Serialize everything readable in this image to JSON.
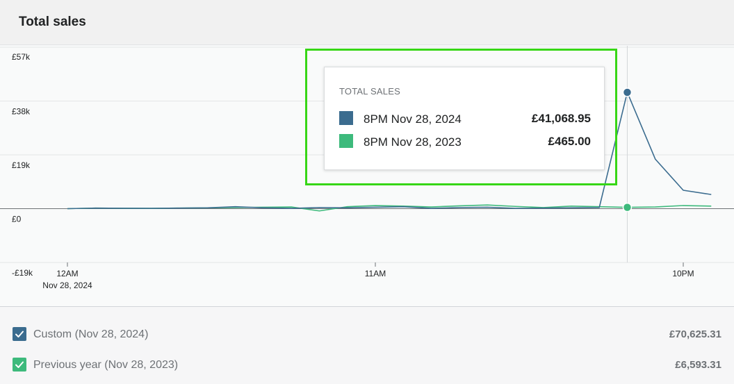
{
  "header": {
    "title": "Total sales"
  },
  "chart_data": {
    "type": "line",
    "title": "Total sales",
    "y_ticks": [
      "£57k",
      "£38k",
      "£19k",
      "£0",
      "-£19k"
    ],
    "ylim": [
      -19000,
      57000
    ],
    "x_ticks": [
      {
        "label": "12AM",
        "sublabel": "Nov 28, 2024",
        "hour": 0
      },
      {
        "label": "11AM",
        "sublabel": "",
        "hour": 11
      },
      {
        "label": "10PM",
        "sublabel": "",
        "hour": 22
      }
    ],
    "x": [
      0,
      1,
      2,
      3,
      4,
      5,
      6,
      7,
      8,
      9,
      10,
      11,
      12,
      13,
      14,
      15,
      16,
      17,
      18,
      19,
      20,
      21,
      22,
      23
    ],
    "series": [
      {
        "name": "Custom (Nov 28, 2024)",
        "color": "#3b6c8f",
        "values": [
          0,
          200,
          150,
          100,
          200,
          300,
          700,
          300,
          100,
          400,
          300,
          500,
          700,
          100,
          400,
          500,
          100,
          200,
          300,
          400,
          41068.95,
          17500,
          6500,
          5000
        ]
      },
      {
        "name": "Previous year (Nov 28, 2023)",
        "color": "#3dba7c",
        "values": [
          0,
          200,
          150,
          100,
          200,
          300,
          400,
          500,
          600,
          -800,
          700,
          1100,
          900,
          600,
          1000,
          1300,
          800,
          400,
          900,
          700,
          465,
          600,
          1100,
          900
        ]
      }
    ],
    "hover_index": 20,
    "grid": true,
    "legend": "bottom"
  },
  "tooltip": {
    "title": "TOTAL SALES",
    "rows": [
      {
        "label": "8PM Nov 28, 2024",
        "value": "£41,068.95",
        "color": "#3b6c8f"
      },
      {
        "label": "8PM Nov 28, 2023",
        "value": "£465.00",
        "color": "#3dba7c"
      }
    ]
  },
  "legend": {
    "items": [
      {
        "label": "Custom (Nov 28, 2024)",
        "value": "£70,625.31",
        "color": "#3b6c8f"
      },
      {
        "label": "Previous year (Nov 28, 2023)",
        "value": "£6,593.31",
        "color": "#3dba7c"
      }
    ]
  }
}
